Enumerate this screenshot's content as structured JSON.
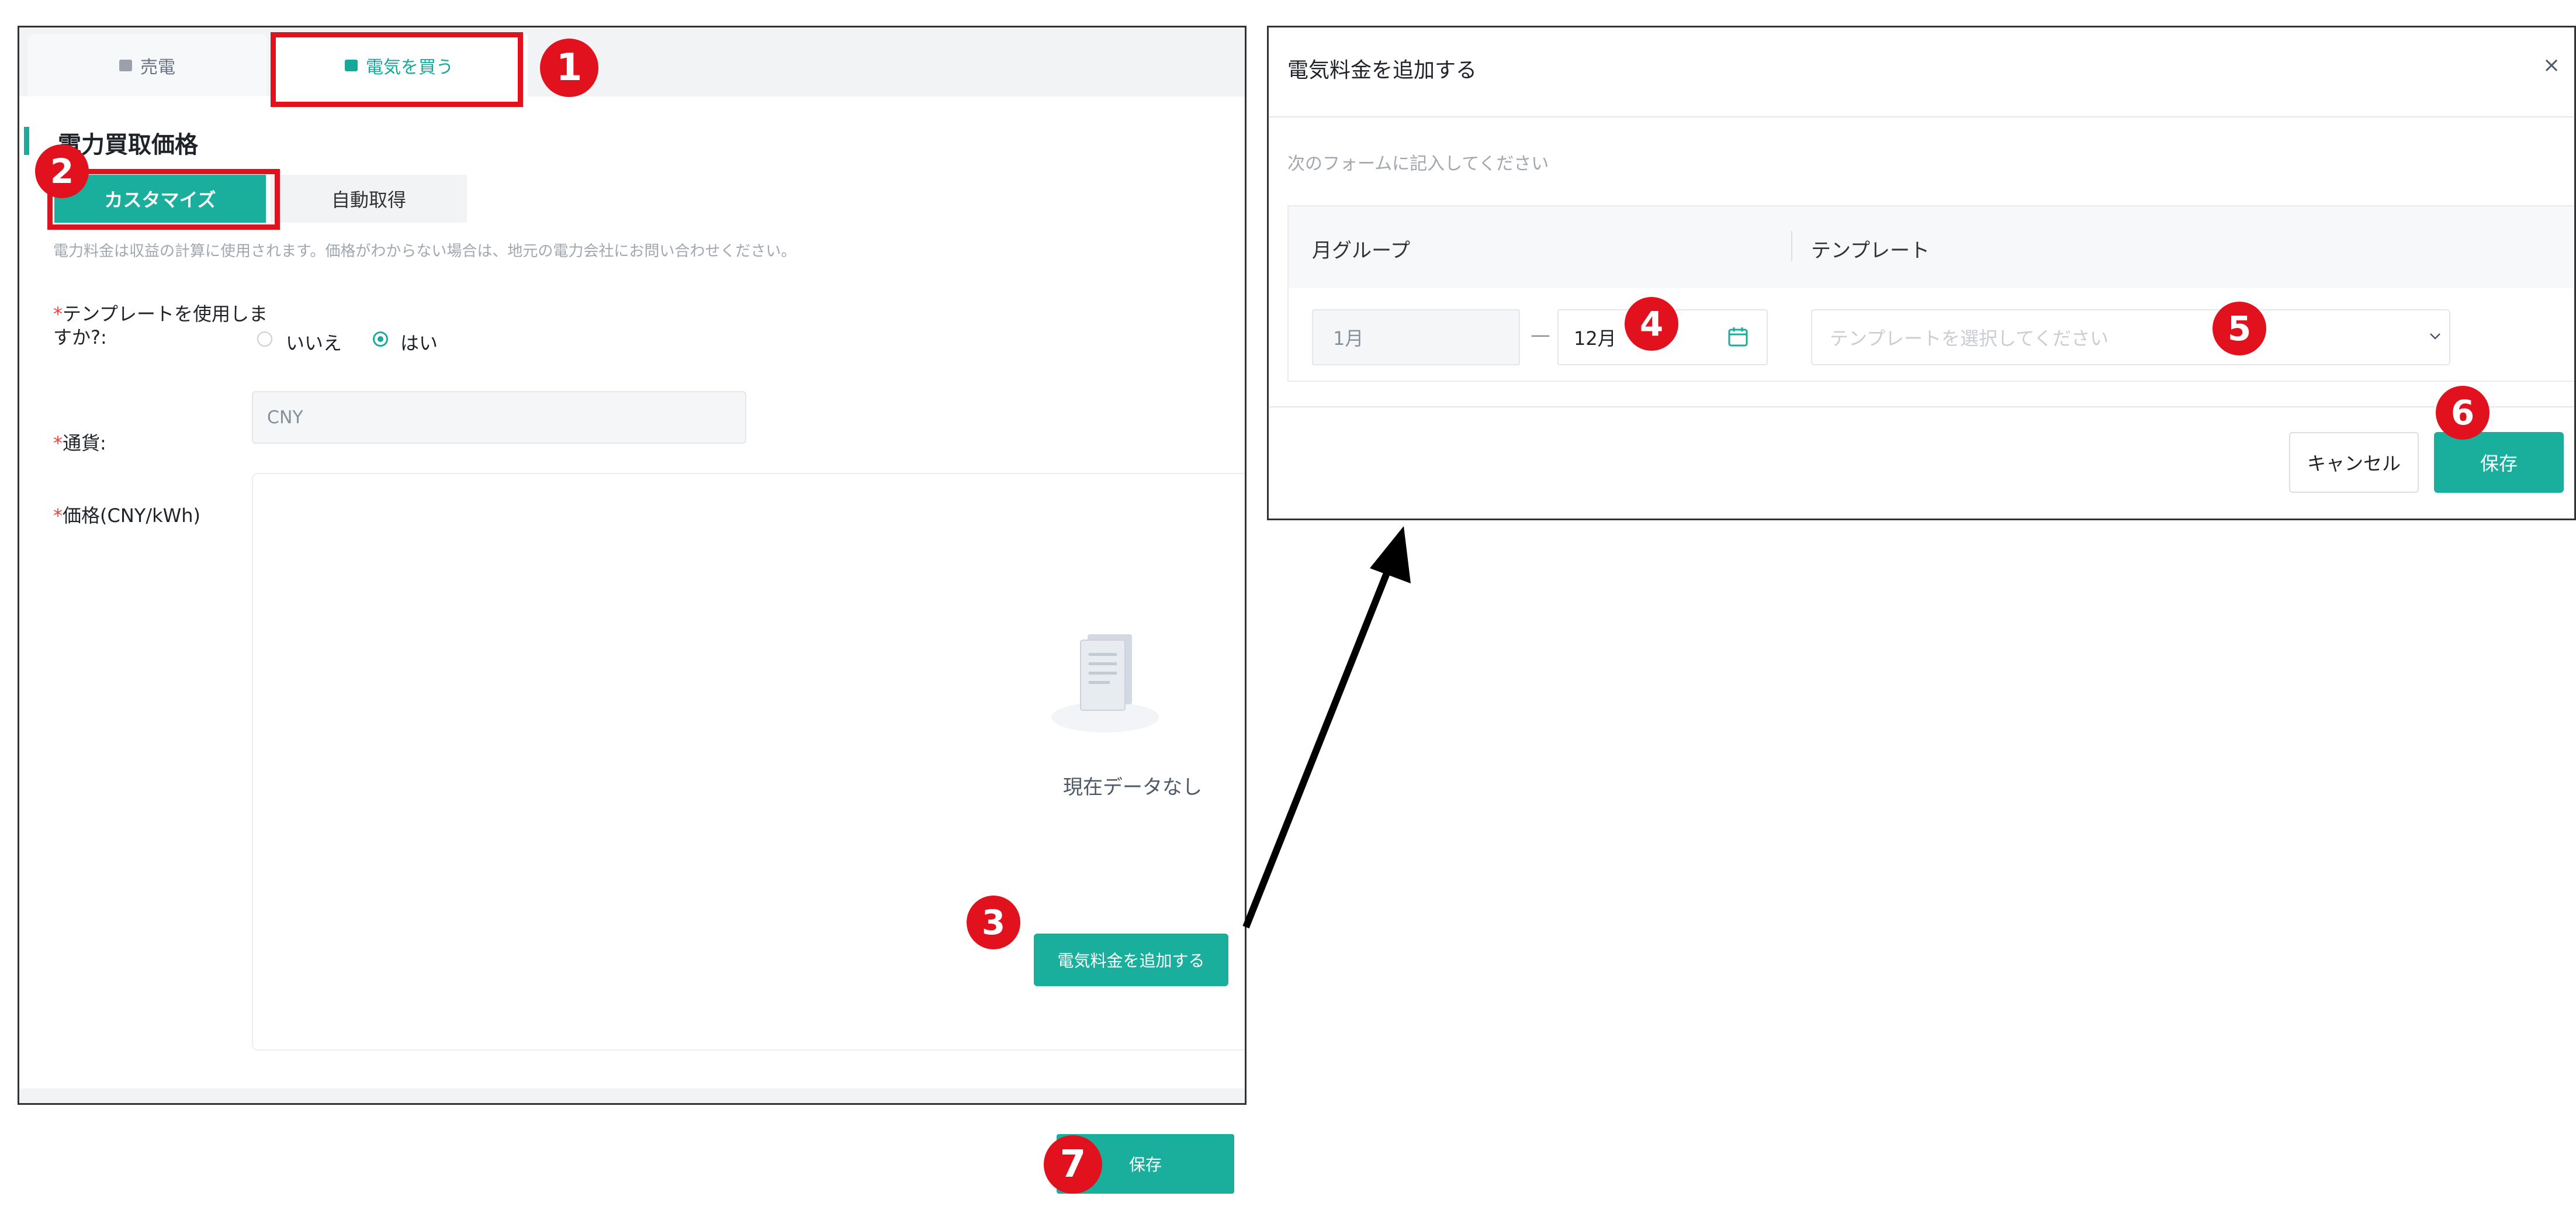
{
  "left_panel": {
    "tabs": [
      {
        "label": "売電",
        "icon": "solar-panel-icon"
      },
      {
        "label": "電気を買う",
        "icon": "plug-icon"
      }
    ],
    "section_title": "電力買取価格",
    "mode_options": [
      "カスタマイズ",
      "自動取得"
    ],
    "hint": "電力料金は収益の計算に使用されます。価格がわからない場合は、地元の電力会社にお問い合わせください。",
    "template_question": {
      "required_mark": "*",
      "label": "テンプレートを使用しますか?:",
      "options": [
        "いいえ",
        "はい"
      ],
      "selected": "はい"
    },
    "currency": {
      "required_mark": "*",
      "label": "通貨:",
      "value": "CNY"
    },
    "price": {
      "required_mark": "*",
      "label": "価格(CNY/kWh)"
    },
    "empty_text": "現在データなし",
    "add_fee_button": "電気料金を追加する"
  },
  "dialog": {
    "title": "電気料金を追加する",
    "close": "×",
    "subtitle": "次のフォームに記入してください",
    "columns": [
      "月グループ",
      "テンプレート"
    ],
    "month_start": "1月",
    "month_dash": "—",
    "month_end": "12月",
    "template_placeholder": "テンプレートを選択してください",
    "cancel": "キャンセル",
    "save": "保存"
  },
  "bottom_save": "保存",
  "markers": [
    "1",
    "2",
    "3",
    "4",
    "5",
    "6",
    "7"
  ],
  "colors": {
    "accent": "#1aaf9c",
    "highlight": "#e1111e",
    "required": "#f53f3f"
  }
}
